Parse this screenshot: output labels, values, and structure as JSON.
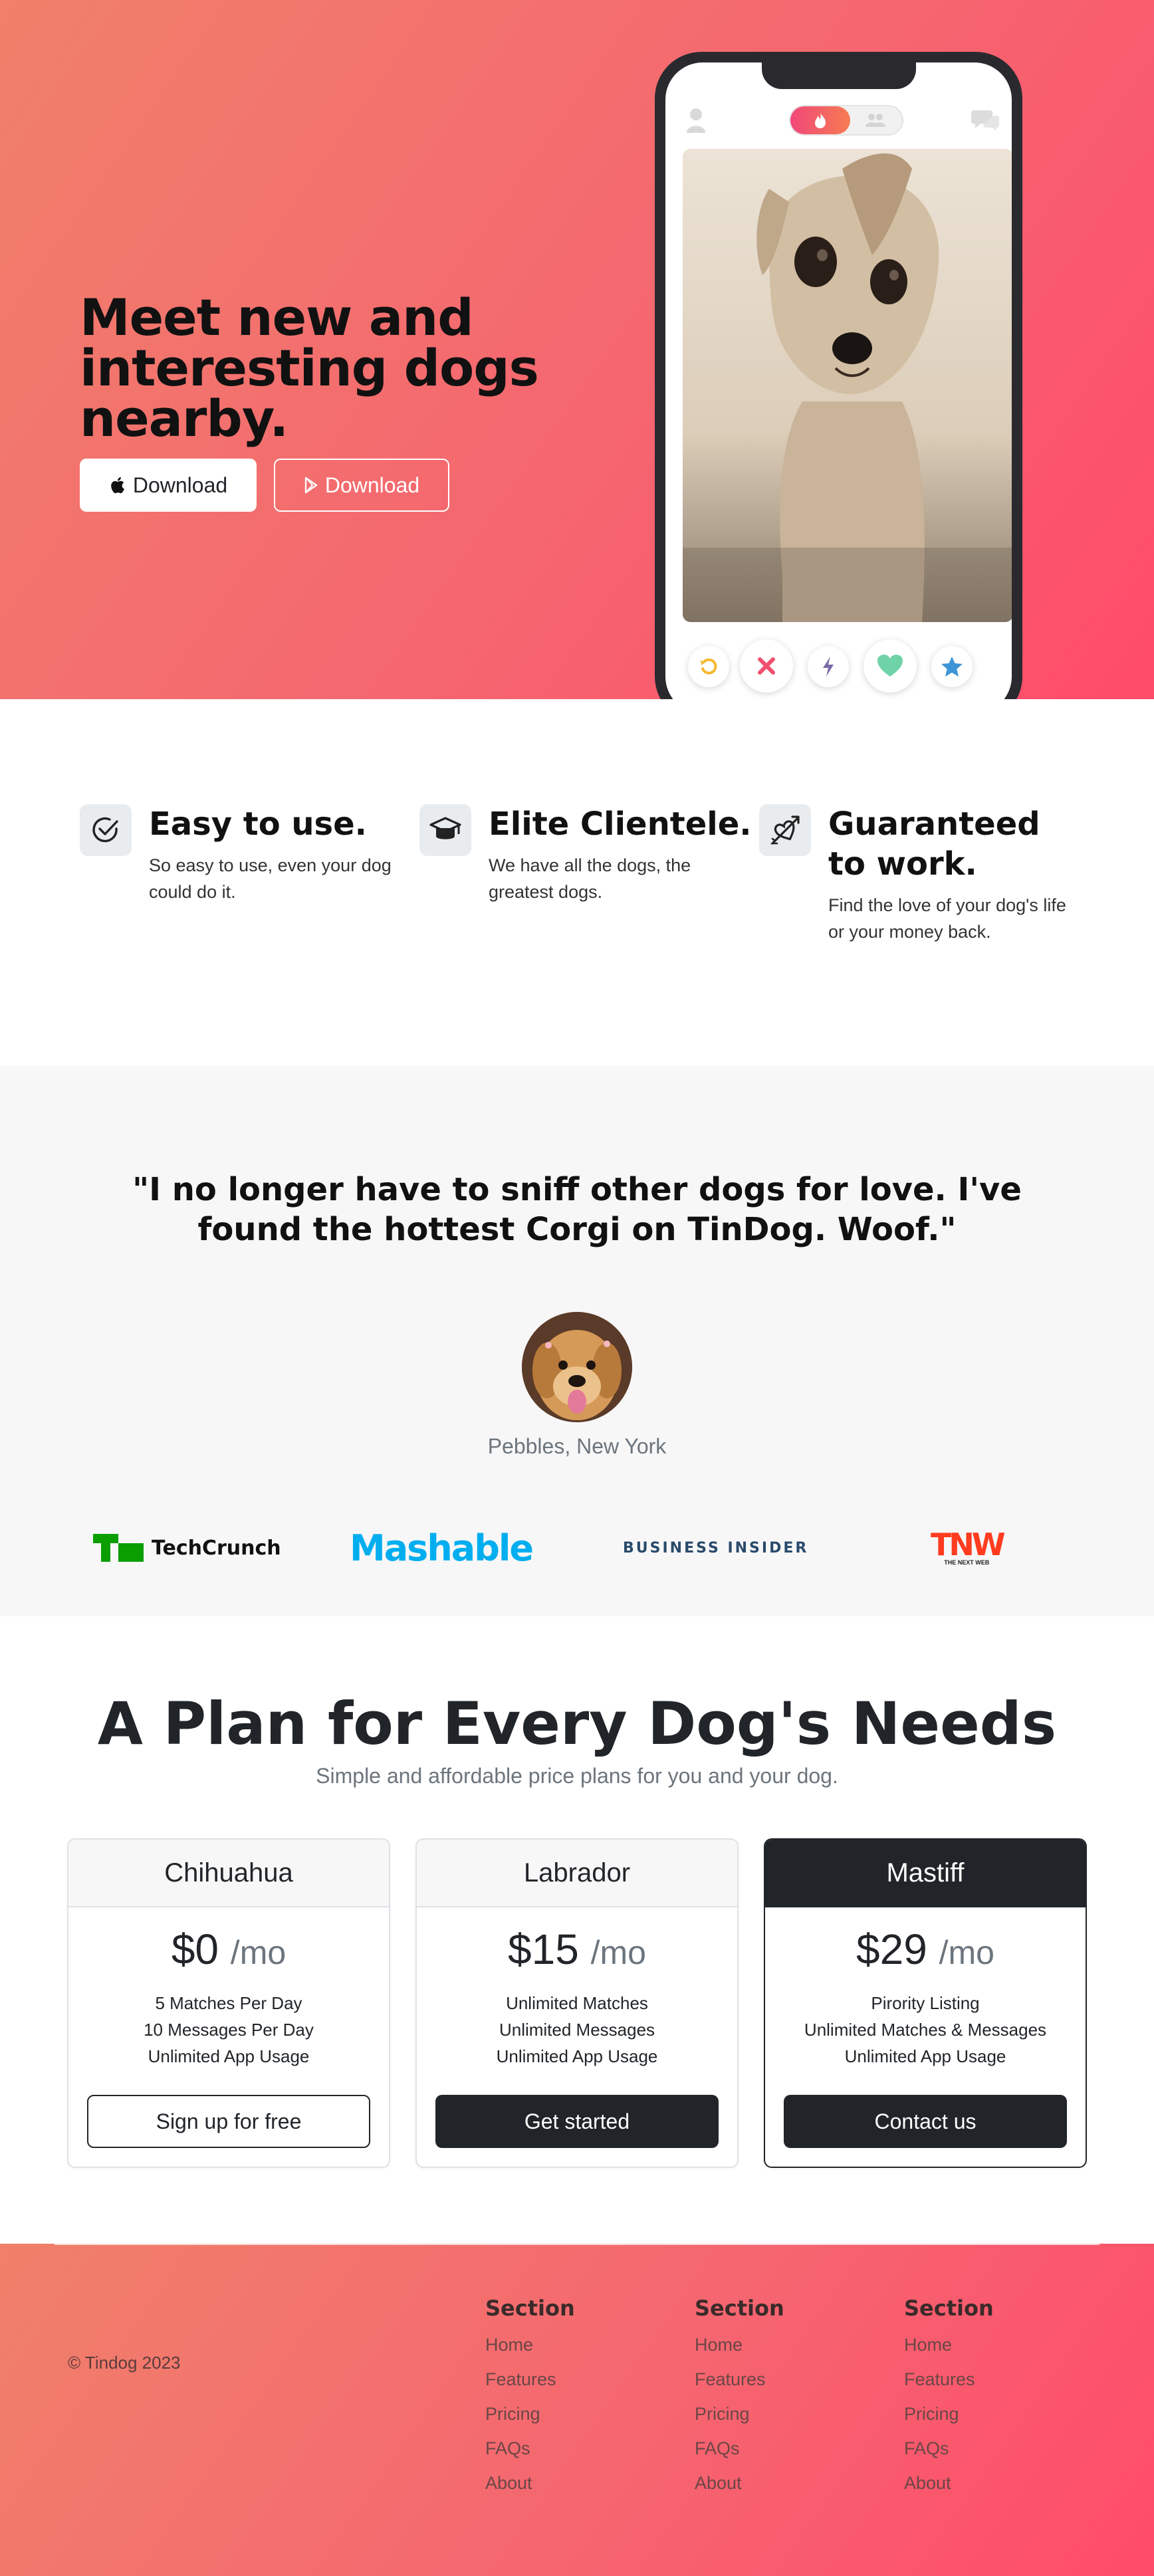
{
  "hero": {
    "title": "Meet new and interesting dogs nearby.",
    "apple_download": "Download",
    "google_download": "Download"
  },
  "features": [
    {
      "title": "Easy to use.",
      "text": "So easy to use, even your dog could do it.",
      "icon": "check-circle-icon"
    },
    {
      "title": "Elite Clientele.",
      "text": "We have all the dogs, the greatest dogs.",
      "icon": "graduation-cap-icon"
    },
    {
      "title": "Guaranteed to work.",
      "text": "Find the love of your dog's life or your money back.",
      "icon": "heart-arrow-icon"
    }
  ],
  "testimonial": {
    "quote": "\"I no longer have to sniff other dogs for love. I've found the hottest Corgi on TinDog. Woof.\"",
    "author": "Pebbles, New York"
  },
  "press": {
    "techcrunch": "TechCrunch",
    "mashable": "Mashable",
    "business_insider": "BUSINESS INSIDER",
    "tnw": "TNW",
    "tnw_sub": "THE NEXT WEB"
  },
  "pricing": {
    "title": "A Plan for Every Dog's Needs",
    "subtitle": "Simple and affordable price plans for you and your dog.",
    "per": "/mo",
    "plans": [
      {
        "name": "Chihuahua",
        "price": "$0",
        "features": [
          "5 Matches Per Day",
          "10 Messages Per Day",
          "Unlimited App Usage"
        ],
        "button": "Sign up for free"
      },
      {
        "name": "Labrador",
        "price": "$15",
        "features": [
          "Unlimited Matches",
          "Unlimited Messages",
          "Unlimited App Usage"
        ],
        "button": "Get started"
      },
      {
        "name": "Mastiff",
        "price": "$29",
        "features": [
          "Pirority Listing",
          "Unlimited Matches & Messages",
          "Unlimited App Usage"
        ],
        "button": "Contact us"
      }
    ]
  },
  "footer": {
    "copyright": "© Tindog 2023",
    "columns": [
      {
        "title": "Section",
        "links": [
          "Home",
          "Features",
          "Pricing",
          "FAQs",
          "About"
        ]
      },
      {
        "title": "Section",
        "links": [
          "Home",
          "Features",
          "Pricing",
          "FAQs",
          "About"
        ]
      },
      {
        "title": "Section",
        "links": [
          "Home",
          "Features",
          "Pricing",
          "FAQs",
          "About"
        ]
      }
    ]
  },
  "colors": {
    "gradient_start": "#f0806a",
    "gradient_end": "#ff4b6a",
    "dark": "#212529",
    "muted": "#6c757d",
    "techcrunch_green": "#0a9e01",
    "mashable_blue": "#00aeef",
    "tnw_red": "#ff3c1f"
  }
}
